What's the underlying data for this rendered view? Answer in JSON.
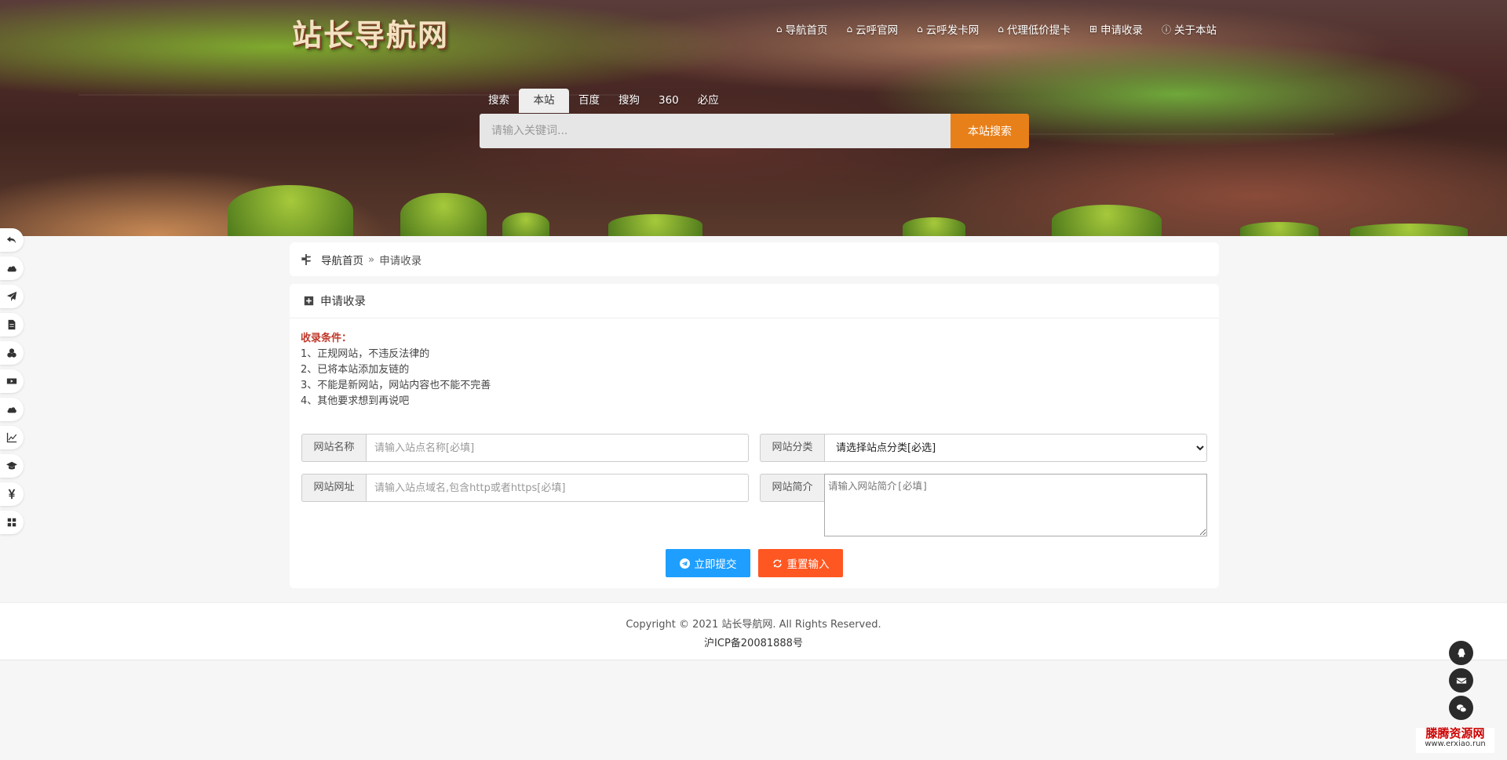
{
  "site": {
    "logo_text": "站长导航网"
  },
  "topnav": [
    {
      "icon": "home-icon",
      "label": "导航首页"
    },
    {
      "icon": "home-icon",
      "label": "云呼官网"
    },
    {
      "icon": "home-icon",
      "label": "云呼发卡网"
    },
    {
      "icon": "home-icon",
      "label": "代理低价提卡"
    },
    {
      "icon": "plus-square-icon",
      "label": "申请收录"
    },
    {
      "icon": "info-circle-icon",
      "label": "关于本站"
    }
  ],
  "search": {
    "lead_label": "搜索",
    "tabs": [
      "本站",
      "百度",
      "搜狗",
      "360",
      "必应"
    ],
    "active_tab": "本站",
    "placeholder": "请输入关键词...",
    "button_label": "本站搜索"
  },
  "sidebar_icons": [
    "undo-icon",
    "cloud-icon",
    "paper-plane-icon",
    "file-icon",
    "cubes-icon",
    "youtube-icon",
    "cloud-icon",
    "line-chart-icon",
    "graduation-cap-icon",
    "yen-icon",
    "grid-icon"
  ],
  "breadcrumb": {
    "home": "导航首页",
    "separator": "»",
    "current": "申请收录"
  },
  "form": {
    "heading": "申请收录",
    "conditions_title": "收录条件：",
    "conditions": [
      "1、正规网站，不违反法律的",
      "2、已将本站添加友链的",
      "3、不能是新网站，网站内容也不能不完善",
      "4、其他要求想到再说吧"
    ],
    "name_label": "网站名称",
    "name_placeholder": "请输入站点名称[必填]",
    "url_label": "网站网址",
    "url_placeholder": "请输入站点域名,包含http或者https[必填]",
    "category_label": "网站分类",
    "category_selected": "请选择站点分类[必选]",
    "intro_label": "网站简介",
    "intro_placeholder": "请输入网站简介[必填]",
    "submit_label": "立即提交",
    "reset_label": "重置输入"
  },
  "footer": {
    "copyright": "Copyright © 2021 站长导航网. All Rights Reserved.",
    "icp": "沪ICP备20081888号"
  },
  "float_buttons": [
    "qq-icon",
    "envelope-icon",
    "wechat-icon"
  ],
  "watermark": {
    "line1": "滕腾资源网",
    "line2": "www.erxiao.run"
  },
  "colors": {
    "accent": "#e8801a",
    "submit": "#1e9fff",
    "reset": "#ff5722",
    "condition_title": "#c0392b"
  }
}
